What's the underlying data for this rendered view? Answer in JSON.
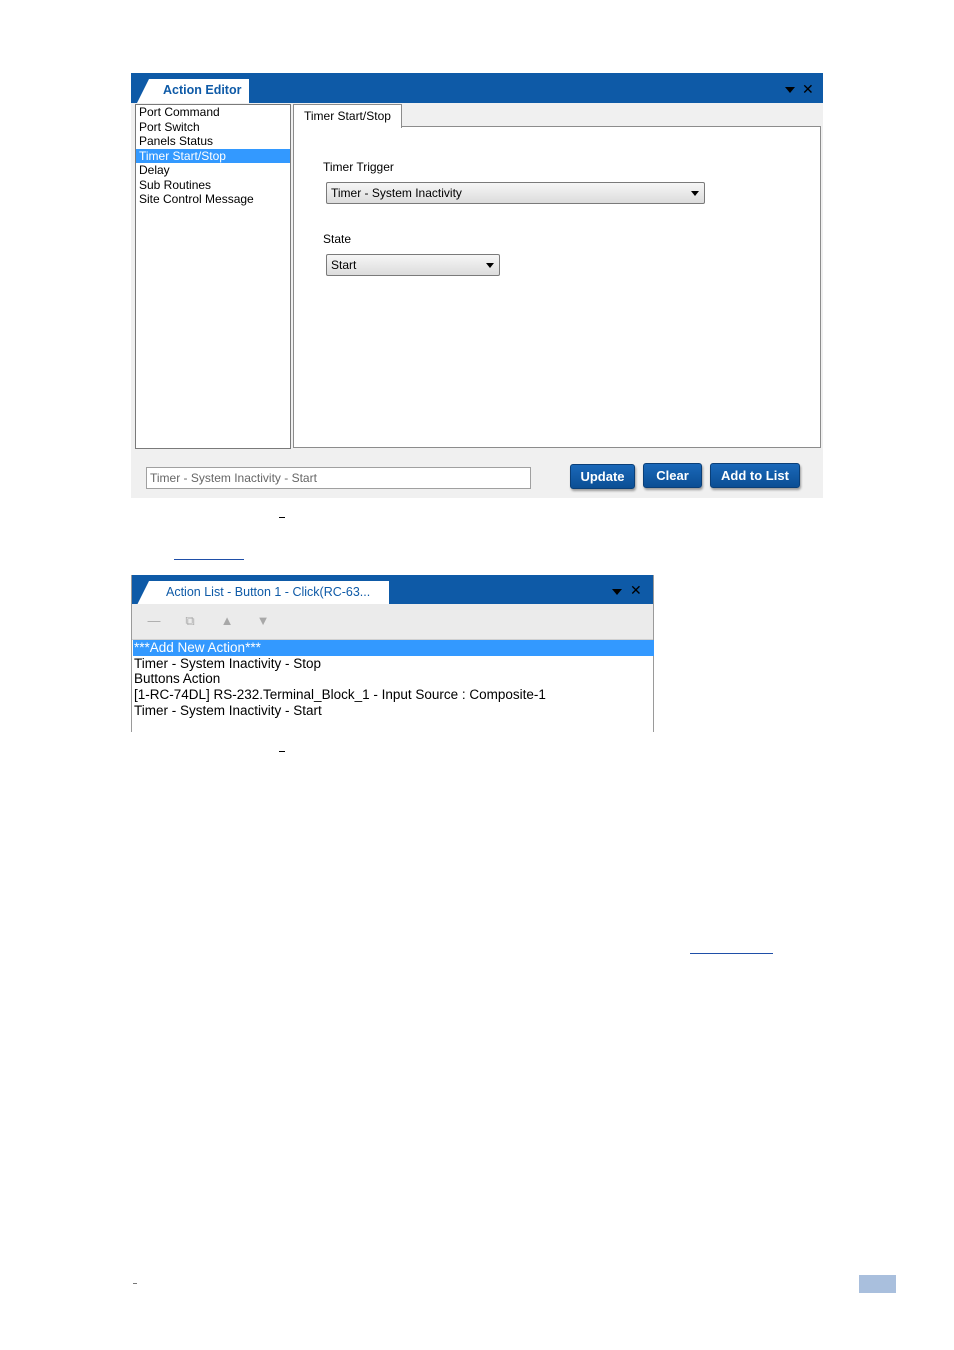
{
  "action_editor": {
    "title": "Action Editor",
    "controls": {
      "menu_icon": "chevron-down-icon",
      "close_label": "✕"
    },
    "categories": [
      {
        "label": "Port Command",
        "selected": false
      },
      {
        "label": "Port Switch",
        "selected": false
      },
      {
        "label": "Panels Status",
        "selected": false
      },
      {
        "label": "Timer Start/Stop",
        "selected": true
      },
      {
        "label": "Delay",
        "selected": false
      },
      {
        "label": "Sub Routines",
        "selected": false
      },
      {
        "label": "Site Control Message",
        "selected": false
      }
    ],
    "tab": "Timer Start/Stop",
    "timer_trigger": {
      "label": "Timer Trigger",
      "value": "Timer - System Inactivity"
    },
    "state": {
      "label": "State",
      "value": "Start"
    },
    "summary_value": "Timer - System Inactivity - Start",
    "buttons": {
      "update": "Update",
      "clear": "Clear",
      "add": "Add to List"
    }
  },
  "action_list": {
    "title": "Action List - Button 1 - Click(RC-63...",
    "controls": {
      "close_label": "✕"
    },
    "toolbar": [
      "minus-icon",
      "copy-icon",
      "arrow-up-icon",
      "arrow-down-icon"
    ],
    "items": [
      {
        "label": "***Add New Action***",
        "selected": true
      },
      {
        "label": "Timer - System Inactivity - Stop",
        "selected": false
      },
      {
        "label": "Buttons Action",
        "selected": false
      },
      {
        "label": "[1-RC-74DL] RS-232.Terminal_Block_1 - Input Source : Composite-1",
        "selected": false
      },
      {
        "label": "Timer - System Inactivity - Start",
        "selected": false
      }
    ]
  },
  "colors": {
    "title_bar": "#0e5aa7",
    "selection": "#3399ff",
    "button": "#0e5aa7",
    "page_badge": "#a9bfdd"
  }
}
